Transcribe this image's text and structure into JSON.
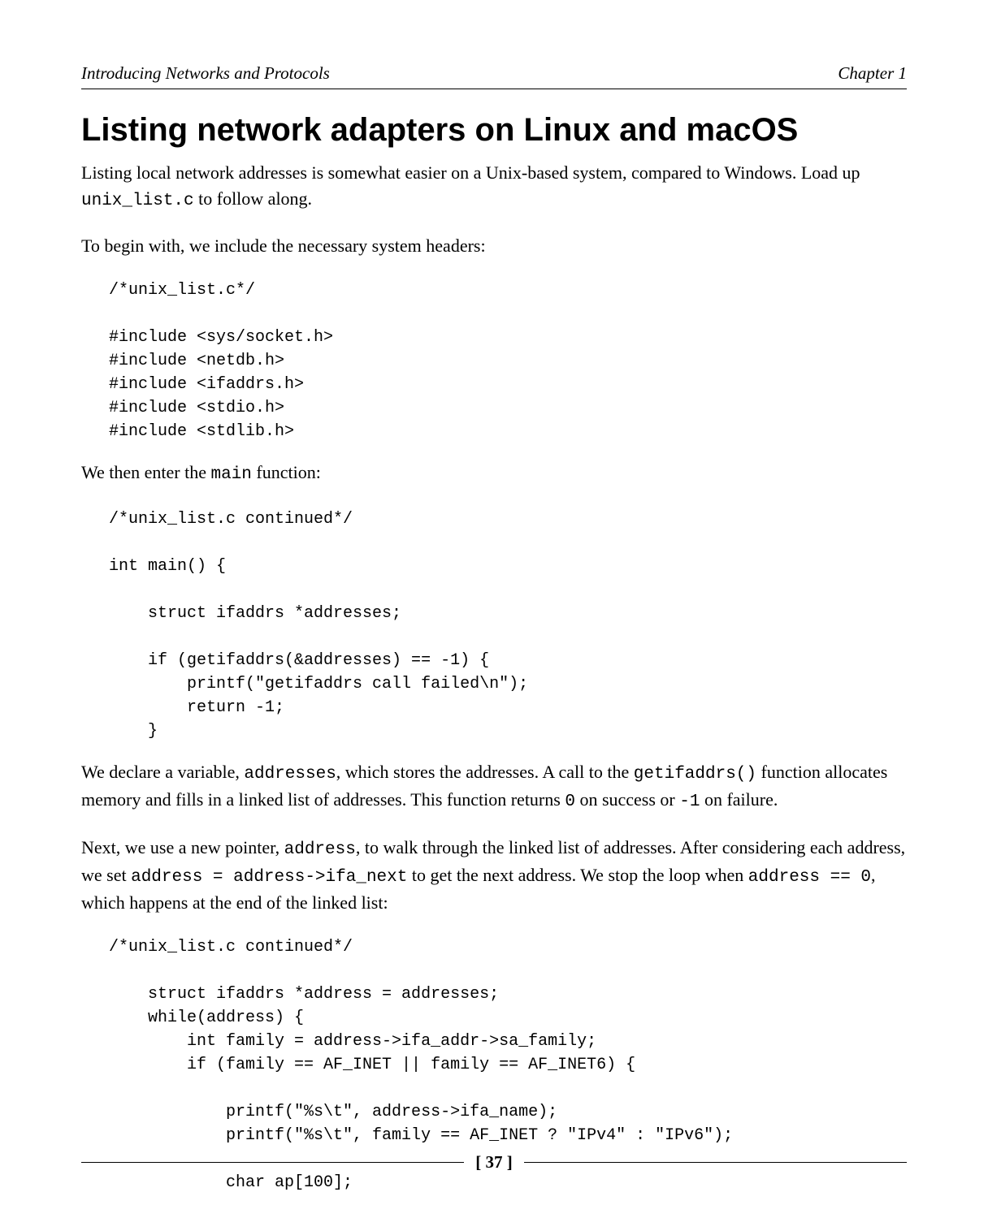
{
  "header": {
    "left": "Introducing Networks and Protocols",
    "right": "Chapter 1"
  },
  "title": "Listing network adapters on Linux and macOS",
  "para1_a": "Listing local network addresses is somewhat easier on a Unix-based system, compared to Windows. Load up ",
  "para1_code": "unix_list.c",
  "para1_b": " to follow along.",
  "para2": "To begin with, we include the necessary system headers:",
  "code1": "/*unix_list.c*/\n\n#include <sys/socket.h>\n#include <netdb.h>\n#include <ifaddrs.h>\n#include <stdio.h>\n#include <stdlib.h>",
  "para3_a": "We then enter the ",
  "para3_code": "main",
  "para3_b": " function:",
  "code2": "/*unix_list.c continued*/\n\nint main() {\n\n    struct ifaddrs *addresses;\n\n    if (getifaddrs(&addresses) == -1) {\n        printf(\"getifaddrs call failed\\n\");\n        return -1;\n    }",
  "para4_a": "We declare a variable, ",
  "para4_code1": "addresses",
  "para4_b": ", which stores the addresses. A call to the ",
  "para4_code2": "getifaddrs()",
  "para4_c": " function allocates memory and fills in a linked list of addresses. This function returns ",
  "para4_code3": "0",
  "para4_d": " on success or ",
  "para4_code4": "-1",
  "para4_e": " on failure.",
  "para5_a": "Next, we use a new pointer, ",
  "para5_code1": "address",
  "para5_b": ", to walk through the linked list of addresses. After considering each address, we set ",
  "para5_code2": "address = address->ifa_next",
  "para5_c": " to get the next address. We stop the loop when ",
  "para5_code3": "address == 0",
  "para5_d": ", which happens at the end of the linked list:",
  "code3": "/*unix_list.c continued*/\n\n    struct ifaddrs *address = addresses;\n    while(address) {\n        int family = address->ifa_addr->sa_family;\n        if (family == AF_INET || family == AF_INET6) {\n\n            printf(\"%s\\t\", address->ifa_name);\n            printf(\"%s\\t\", family == AF_INET ? \"IPv4\" : \"IPv6\");\n\n            char ap[100];",
  "page_number": "[ 37 ]"
}
